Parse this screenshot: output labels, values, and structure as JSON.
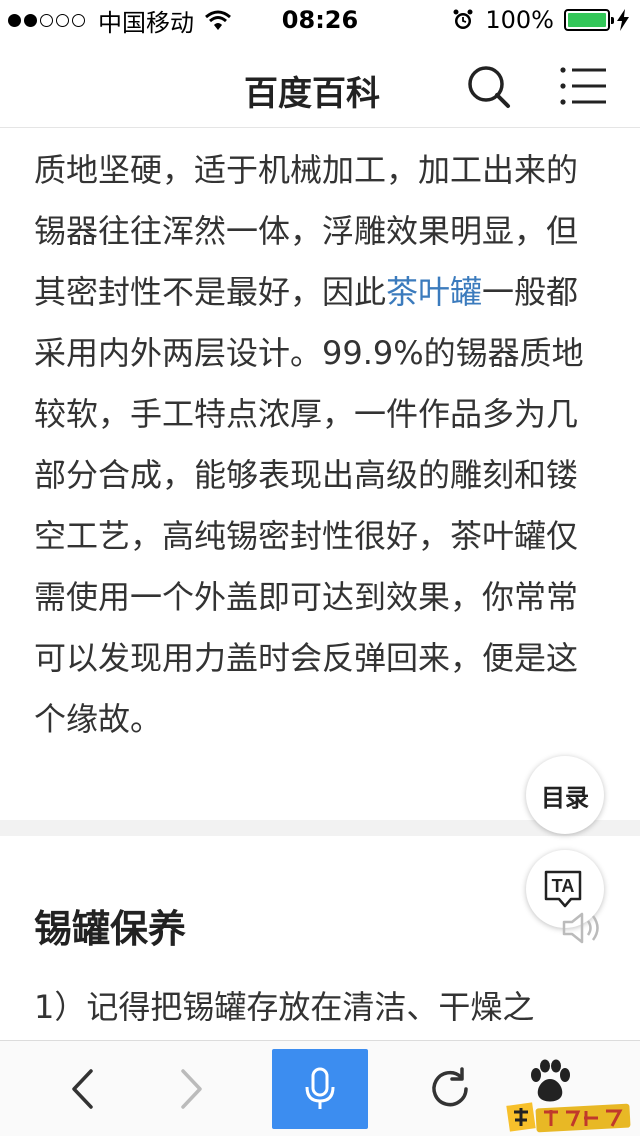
{
  "status_bar": {
    "carrier": "中国移动",
    "time": "08:26",
    "battery_percent": "100%",
    "battery_level": 1.0,
    "signal_strength_filled": 2,
    "signal_strength_total": 5
  },
  "header": {
    "title": "百度百科",
    "search_icon": "search-icon",
    "menu_icon": "menu-icon"
  },
  "article": {
    "para_start": "质地坚硬，适于机械加工，加工出来的锡器往往浑然一体，浮雕效果明显，但其密封性不是最好，因此",
    "link": "茶叶罐",
    "para_end": "一般都采用内外两层设计。99.9%的锡器质地较软，手工特点浓厚，一件作品多为几部分合成，能够表现出高级的雕刻和镂空工艺，高纯锡密封性很好，茶叶罐仅需使用一个外盖即可达到效果，你常常可以发现用力盖时会反弹回来，便是这个缘故。"
  },
  "section": {
    "heading": "锡罐保养",
    "first_line": "1）记得把锡罐存放在清洁、干燥之"
  },
  "floating": {
    "toc_label": "目录",
    "ta_label": "TA"
  },
  "toolbar": {
    "back_icon": "chevron-left-icon",
    "forward_icon": "chevron-right-icon",
    "voice_icon": "microphone-icon",
    "refresh_icon": "refresh-icon",
    "paw_icon": "baidu-paw-icon"
  },
  "colors": {
    "link": "#3b7bbd",
    "voice_button": "#3c8df0",
    "battery": "#34c759",
    "divider": "#f2f2f2"
  }
}
